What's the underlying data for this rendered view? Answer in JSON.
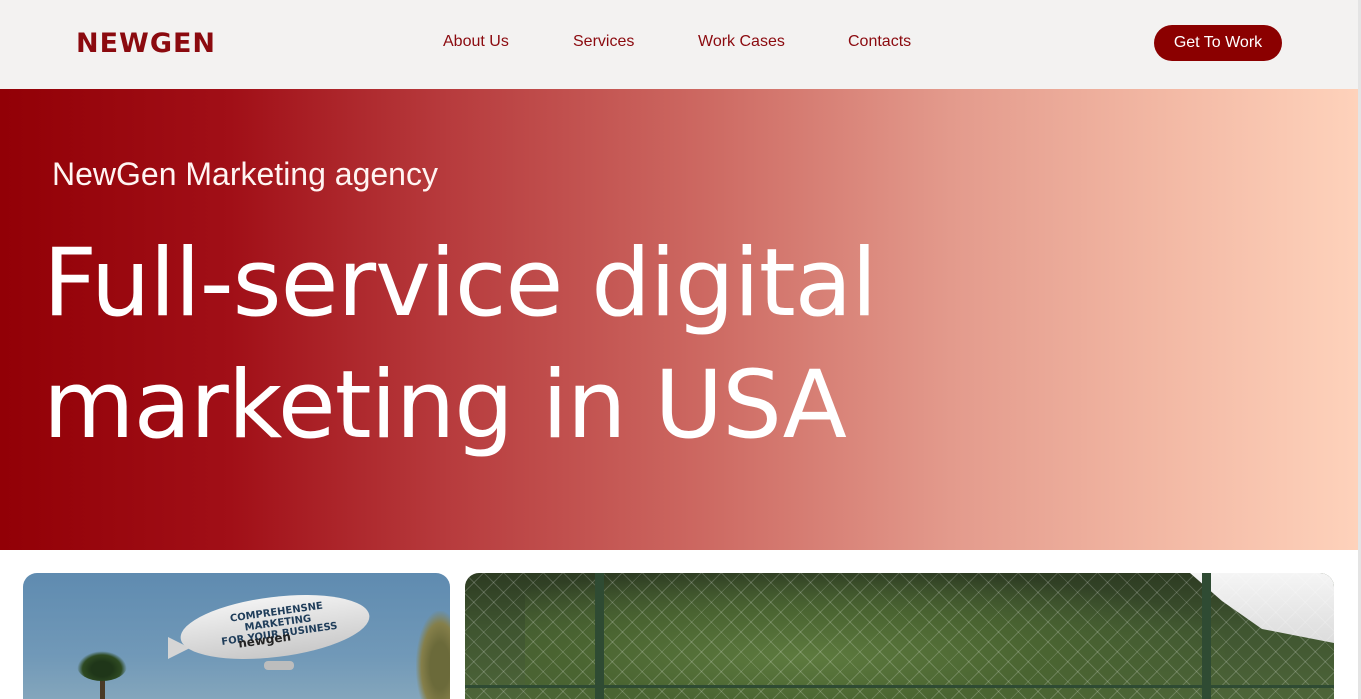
{
  "header": {
    "logo": "NEWGEN",
    "nav": [
      {
        "label": "About Us"
      },
      {
        "label": "Services"
      },
      {
        "label": "Work Cases"
      },
      {
        "label": "Contacts"
      }
    ],
    "cta_label": "Get To Work"
  },
  "hero": {
    "subtitle": "NewGen Marketing agency",
    "headline_line1": "Full-service digital",
    "headline_line2": "marketing in USA"
  },
  "cards": {
    "blimp_text_line1": "COMPREHENSNE MARKETING",
    "blimp_text_line2": "FOR YOUR BUSINESS",
    "blimp_brand": "newgen"
  },
  "colors": {
    "brand": "#8b0a0f",
    "cta_bg": "#8b0000",
    "header_bg": "#f3f2f1",
    "hero_start": "#920006",
    "hero_end": "#fed2bb"
  }
}
